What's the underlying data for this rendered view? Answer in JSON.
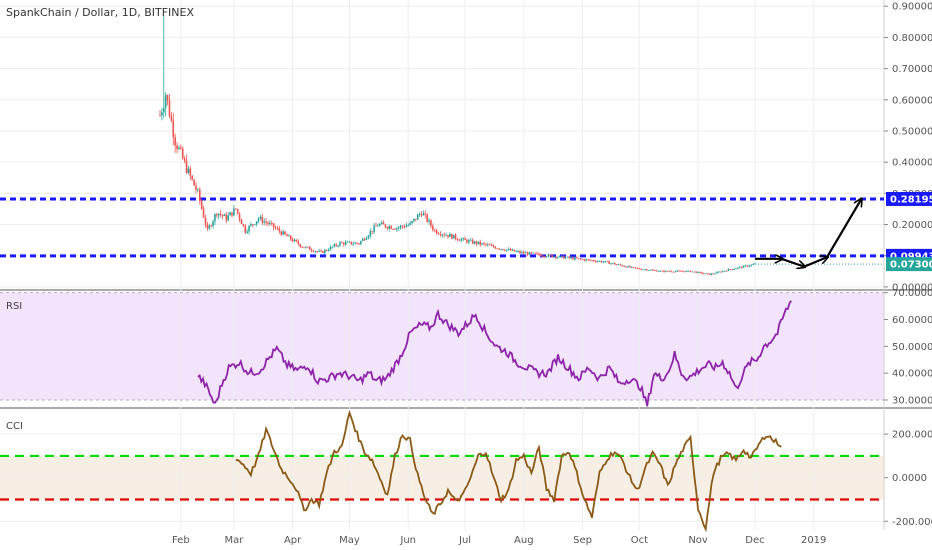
{
  "header": {
    "title": "SpankChain / Dollar, 1D, BITFINEX"
  },
  "colors": {
    "up": "#26a69a",
    "down": "#ef5350",
    "rsi": "#8e24aa",
    "cci": "#8b5a16",
    "level_blue": "#1a1aff",
    "cci_upper": "#00dd00",
    "cci_lower": "#e00000",
    "rsi_band": "#f1e4fb",
    "cci_band": "#f7efe4",
    "grid": "#eeeeee"
  },
  "chart_data": [
    {
      "pane": "price",
      "type": "candlestick",
      "x_ticks": [
        "Feb",
        "Mar",
        "Apr",
        "May",
        "Jun",
        "Jul",
        "Aug",
        "Sep",
        "Oct",
        "Nov",
        "Dec",
        "2019"
      ],
      "y_ticks": [
        "0.90000",
        "0.80000",
        "0.70000",
        "0.60000",
        "0.50000",
        "0.40000",
        "0.30000",
        "0.20000",
        "0.10000",
        "0.00000"
      ],
      "ylim": [
        -0.01,
        0.92
      ],
      "levels": [
        {
          "value": 0.28195,
          "label": "0.28195"
        },
        {
          "value": 0.09943,
          "label": "0.09943"
        }
      ],
      "last_price": {
        "value": 0.073,
        "label": "0.07300"
      },
      "close_anchors": [
        [
          0,
          0.55
        ],
        [
          3,
          0.62
        ],
        [
          8,
          0.47
        ],
        [
          14,
          0.38
        ],
        [
          20,
          0.3
        ],
        [
          25,
          0.18
        ],
        [
          30,
          0.24
        ],
        [
          35,
          0.22
        ],
        [
          40,
          0.25
        ],
        [
          45,
          0.18
        ],
        [
          52,
          0.22
        ],
        [
          58,
          0.2
        ],
        [
          65,
          0.17
        ],
        [
          75,
          0.13
        ],
        [
          85,
          0.11
        ],
        [
          95,
          0.14
        ],
        [
          105,
          0.14
        ],
        [
          115,
          0.2
        ],
        [
          125,
          0.19
        ],
        [
          132,
          0.2
        ],
        [
          138,
          0.24
        ],
        [
          145,
          0.18
        ],
        [
          160,
          0.15
        ],
        [
          175,
          0.13
        ],
        [
          190,
          0.11
        ],
        [
          205,
          0.1
        ],
        [
          220,
          0.09
        ],
        [
          235,
          0.08
        ],
        [
          250,
          0.06
        ],
        [
          265,
          0.05
        ],
        [
          280,
          0.05
        ],
        [
          290,
          0.04
        ],
        [
          300,
          0.055
        ],
        [
          308,
          0.065
        ],
        [
          314,
          0.073
        ]
      ],
      "projection": [
        [
          314,
          0.09
        ],
        [
          328,
          0.09
        ],
        [
          340,
          0.065
        ],
        [
          352,
          0.095
        ],
        [
          370,
          0.28
        ]
      ]
    },
    {
      "pane": "rsi",
      "type": "line",
      "title": "RSI",
      "y_ticks": [
        "70.0000",
        "60.0000",
        "50.0000",
        "40.0000",
        "30.0000"
      ],
      "ylim": [
        27,
        71
      ],
      "band": [
        30,
        70
      ],
      "anchors": [
        [
          0,
          39
        ],
        [
          4,
          36
        ],
        [
          8,
          31
        ],
        [
          10,
          28
        ],
        [
          14,
          36
        ],
        [
          18,
          42
        ],
        [
          24,
          44
        ],
        [
          30,
          40
        ],
        [
          36,
          41
        ],
        [
          42,
          46
        ],
        [
          46,
          49
        ],
        [
          52,
          43
        ],
        [
          58,
          41
        ],
        [
          64,
          43
        ],
        [
          70,
          37
        ],
        [
          76,
          38
        ],
        [
          82,
          40
        ],
        [
          88,
          39
        ],
        [
          94,
          37
        ],
        [
          100,
          40
        ],
        [
          104,
          37
        ],
        [
          110,
          38
        ],
        [
          114,
          42
        ],
        [
          118,
          46
        ],
        [
          124,
          55
        ],
        [
          130,
          58
        ],
        [
          136,
          57
        ],
        [
          140,
          62
        ],
        [
          146,
          58
        ],
        [
          152,
          55
        ],
        [
          158,
          59
        ],
        [
          162,
          62
        ],
        [
          168,
          55
        ],
        [
          174,
          50
        ],
        [
          180,
          48
        ],
        [
          186,
          44
        ],
        [
          192,
          42
        ],
        [
          198,
          40
        ],
        [
          204,
          40
        ],
        [
          210,
          46
        ],
        [
          216,
          42
        ],
        [
          222,
          38
        ],
        [
          228,
          42
        ],
        [
          234,
          38
        ],
        [
          240,
          42
        ],
        [
          246,
          36
        ],
        [
          252,
          38
        ],
        [
          258,
          35
        ],
        [
          262,
          28
        ],
        [
          266,
          40
        ],
        [
          270,
          38
        ],
        [
          274,
          40
        ],
        [
          278,
          47
        ],
        [
          282,
          40
        ],
        [
          286,
          38
        ],
        [
          290,
          40
        ],
        [
          294,
          42
        ],
        [
          298,
          43
        ],
        [
          302,
          42
        ],
        [
          306,
          44
        ],
        [
          310,
          40
        ],
        [
          314,
          34
        ],
        [
          318,
          40
        ],
        [
          322,
          44
        ],
        [
          326,
          45
        ],
        [
          330,
          50
        ],
        [
          334,
          52
        ],
        [
          338,
          55
        ],
        [
          342,
          62
        ],
        [
          346,
          67
        ]
      ]
    },
    {
      "pane": "cci",
      "type": "line",
      "title": "CCI",
      "y_ticks": [
        "200.0000",
        "0.0000",
        "-200.0000"
      ],
      "ylim": [
        -240,
        320
      ],
      "levels": [
        100,
        -100
      ],
      "anchors": [
        [
          0,
          90
        ],
        [
          4,
          60
        ],
        [
          8,
          20
        ],
        [
          12,
          100
        ],
        [
          16,
          220
        ],
        [
          20,
          130
        ],
        [
          24,
          40
        ],
        [
          28,
          0
        ],
        [
          32,
          -50
        ],
        [
          36,
          -150
        ],
        [
          40,
          -100
        ],
        [
          44,
          -120
        ],
        [
          48,
          20
        ],
        [
          52,
          120
        ],
        [
          56,
          140
        ],
        [
          60,
          300
        ],
        [
          64,
          200
        ],
        [
          68,
          120
        ],
        [
          72,
          80
        ],
        [
          76,
          0
        ],
        [
          80,
          -80
        ],
        [
          84,
          100
        ],
        [
          88,
          200
        ],
        [
          92,
          170
        ],
        [
          96,
          10
        ],
        [
          100,
          -100
        ],
        [
          104,
          -170
        ],
        [
          108,
          -120
        ],
        [
          112,
          -60
        ],
        [
          116,
          -110
        ],
        [
          120,
          -80
        ],
        [
          124,
          0
        ],
        [
          128,
          100
        ],
        [
          132,
          120
        ],
        [
          136,
          0
        ],
        [
          140,
          -100
        ],
        [
          144,
          -60
        ],
        [
          148,
          80
        ],
        [
          152,
          100
        ],
        [
          156,
          20
        ],
        [
          160,
          140
        ],
        [
          164,
          -50
        ],
        [
          168,
          -100
        ],
        [
          172,
          100
        ],
        [
          176,
          120
        ],
        [
          180,
          20
        ],
        [
          184,
          -100
        ],
        [
          188,
          -180
        ],
        [
          192,
          20
        ],
        [
          196,
          90
        ],
        [
          200,
          120
        ],
        [
          204,
          80
        ],
        [
          208,
          0
        ],
        [
          212,
          -60
        ],
        [
          216,
          40
        ],
        [
          220,
          110
        ],
        [
          224,
          60
        ],
        [
          228,
          -40
        ],
        [
          232,
          60
        ],
        [
          236,
          130
        ],
        [
          240,
          180
        ],
        [
          244,
          -140
        ],
        [
          248,
          -230
        ],
        [
          252,
          20
        ],
        [
          256,
          90
        ],
        [
          260,
          110
        ],
        [
          264,
          80
        ],
        [
          268,
          130
        ],
        [
          272,
          90
        ],
        [
          276,
          150
        ],
        [
          280,
          200
        ],
        [
          284,
          170
        ],
        [
          288,
          150
        ]
      ]
    }
  ]
}
